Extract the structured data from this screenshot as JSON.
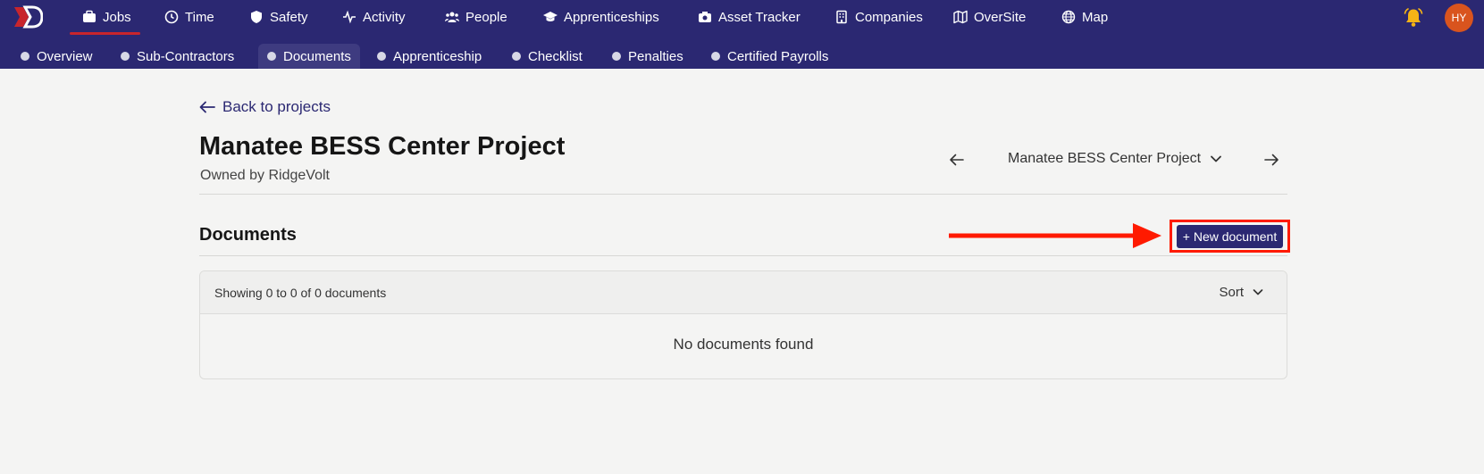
{
  "nav": {
    "items": [
      {
        "label": "Jobs",
        "icon": "briefcase-icon"
      },
      {
        "label": "Time",
        "icon": "clock-icon"
      },
      {
        "label": "Safety",
        "icon": "shield-icon"
      },
      {
        "label": "Activity",
        "icon": "activity-icon"
      },
      {
        "label": "People",
        "icon": "people-icon"
      },
      {
        "label": "Apprenticeships",
        "icon": "graduation-cap-icon"
      },
      {
        "label": "Asset Tracker",
        "icon": "camera-icon"
      },
      {
        "label": "Companies",
        "icon": "building-icon"
      },
      {
        "label": "OverSite",
        "icon": "map-fold-icon"
      },
      {
        "label": "Map",
        "icon": "globe-icon"
      }
    ],
    "active": "Jobs",
    "avatar_initials": "HY"
  },
  "subnav": {
    "items": [
      "Overview",
      "Sub-Contractors",
      "Documents",
      "Apprenticeship",
      "Checklist",
      "Penalties",
      "Certified Payrolls"
    ],
    "active": "Documents"
  },
  "page": {
    "back_label": "Back to projects",
    "title": "Manatee BESS Center Project",
    "owner": "Owned by RidgeVolt",
    "project_selector": "Manatee BESS Center Project"
  },
  "documents": {
    "heading": "Documents",
    "new_button": "+ New document",
    "showing": "Showing 0 to 0 of 0 documents",
    "sort_label": "Sort",
    "empty_message": "No documents found"
  },
  "colors": {
    "nav_bg": "#2b2872",
    "accent_red": "#c8252c",
    "annotation_red": "#ff1a00",
    "avatar_bg": "#d9541e",
    "bell": "#f5b316"
  }
}
